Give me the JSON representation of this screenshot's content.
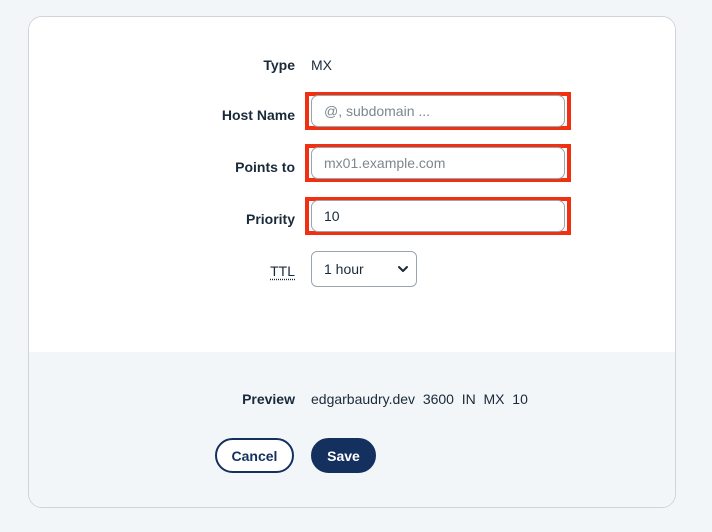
{
  "form": {
    "type": {
      "label": "Type",
      "value": "MX"
    },
    "host_name": {
      "label": "Host Name",
      "value": "",
      "placeholder": "@, subdomain ..."
    },
    "points_to": {
      "label": "Points to",
      "value": "",
      "placeholder": "mx01.example.com"
    },
    "priority": {
      "label": "Priority",
      "value": "10"
    },
    "ttl": {
      "label": "TTL",
      "selected": "1 hour"
    }
  },
  "preview": {
    "label": "Preview",
    "value": "edgarbaudry.dev  3600  IN  MX  10"
  },
  "actions": {
    "cancel_label": "Cancel",
    "save_label": "Save"
  },
  "colors": {
    "accent": "#14305e",
    "highlight": "#f03010"
  },
  "icons": {
    "ttl_dropdown": "chevron-down-icon"
  }
}
